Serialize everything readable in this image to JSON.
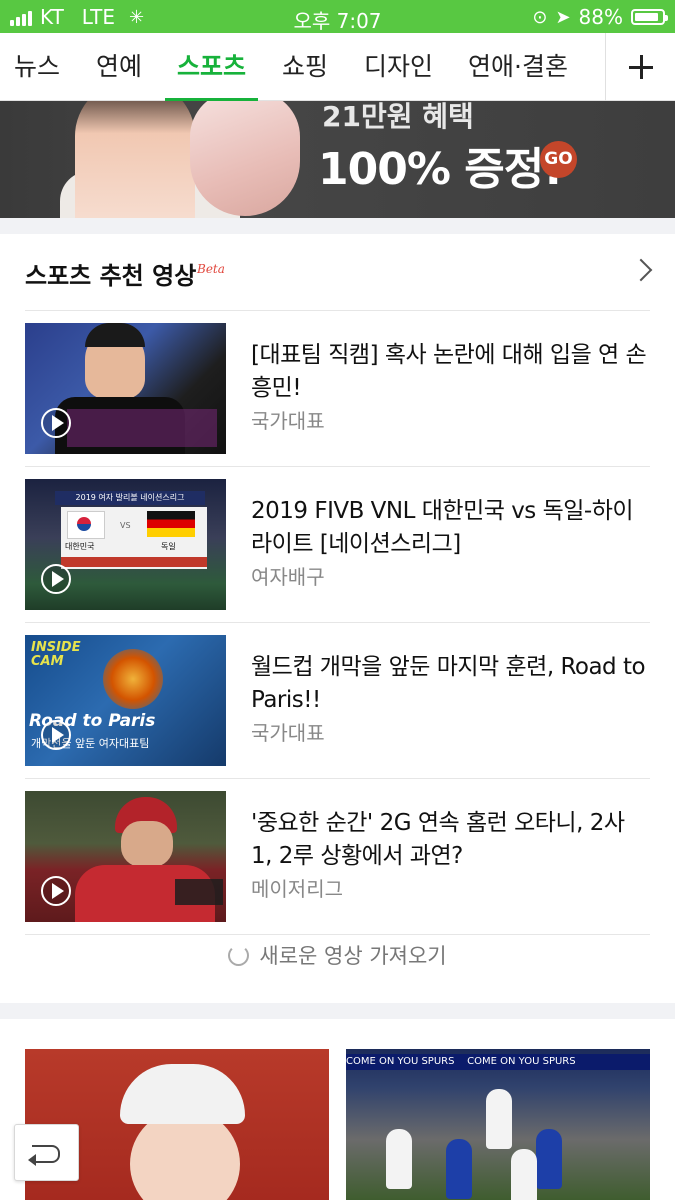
{
  "status_bar": {
    "carrier": "KT",
    "network": "LTE",
    "time": "오후 7:07",
    "battery": "88%",
    "battery_level": 0.88
  },
  "tabs": [
    {
      "label": "뉴스"
    },
    {
      "label": "연예"
    },
    {
      "label": "스포츠",
      "active": true
    },
    {
      "label": "쇼핑"
    },
    {
      "label": "디자인"
    },
    {
      "label": "연애·결혼"
    }
  ],
  "ad": {
    "line1": "21만원 혜택",
    "headline": "100% 증정!",
    "go": "GO"
  },
  "section": {
    "title": "스포츠 추천 영상",
    "badge": "Beta"
  },
  "videos": [
    {
      "title": "[대표팀 직캠] 혹사 논란에 대해 입을 연 손흥민!",
      "category": "국가대표"
    },
    {
      "title": "2019 FIVB VNL 대한민국 vs 독일-하이라이트 [네이션스리그]",
      "category": "여자배구"
    },
    {
      "title": "월드컵 개막을 앞둔 마지막 훈련, Road to Paris!!",
      "category": "국가대표"
    },
    {
      "title": "'중요한 순간' 2G 연속 홈런 오타니, 2사 1, 2루 상황에서 과연?",
      "category": "메이저리그"
    }
  ],
  "thumb_text": {
    "t2_header": "2019 여자 발리볼 네이션스리그",
    "t2_team1": "대한민국",
    "t2_vs": "VS",
    "t2_team2": "독일",
    "t3_top": "INSIDE CAM",
    "t3_road": "Road to Paris",
    "t3_sub": "개막전을 앞둔 여자대표팀"
  },
  "refresh_label": "새로운 영상 가져오기",
  "bottom_banner": "COME ON YOU SPURS"
}
